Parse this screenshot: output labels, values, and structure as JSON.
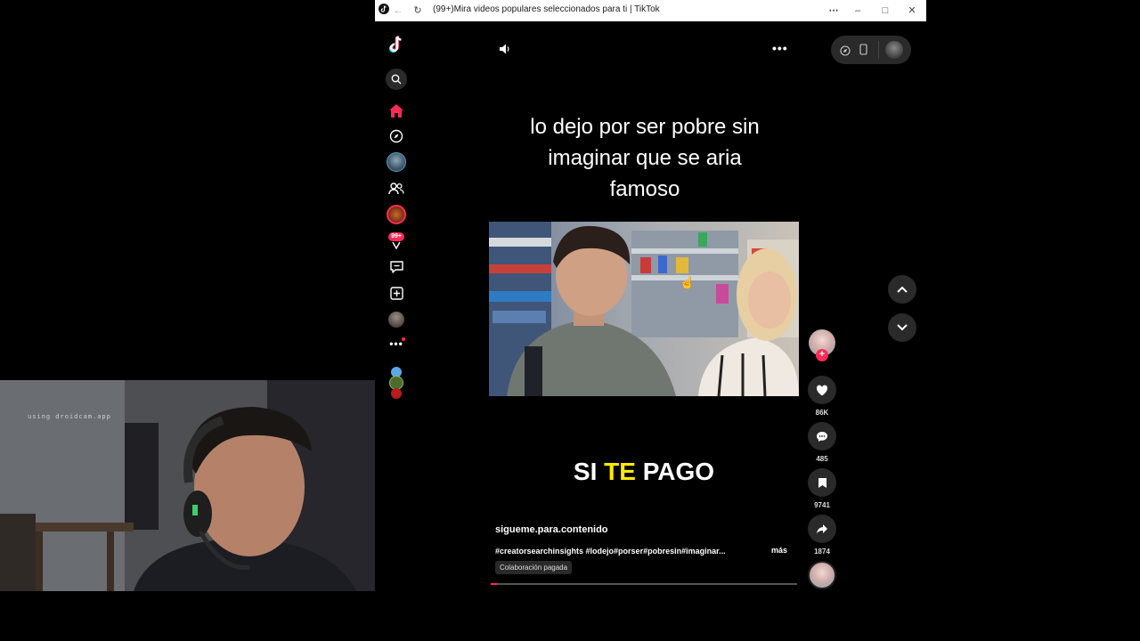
{
  "browser": {
    "title": "(99+)Mira videos populares seleccionados para ti | TikTok"
  },
  "sidebar": {
    "notification_badge": "99+"
  },
  "video": {
    "caption_lines": [
      "lo dejo por ser pobre sin",
      "imaginar que se aria",
      "famoso"
    ],
    "overlay_text_white_1": "SI",
    "overlay_text_yellow": "TE",
    "overlay_text_white_2": "PAGO",
    "author": "sigueme.para.contenido",
    "hashtags": "#creatorsearchinsights #lodejo#porser#pobresin#imaginar...",
    "more_label": "más",
    "paid_tag": "Colaboración pagada",
    "progress": 0.02
  },
  "actions": {
    "likes": "86K",
    "comments": "485",
    "saves": "9741",
    "shares": "1874"
  },
  "webcam": {
    "watermark": "using droidcam.app"
  },
  "colors": {
    "accent": "#fe2c55",
    "highlight": "#ffe900"
  }
}
